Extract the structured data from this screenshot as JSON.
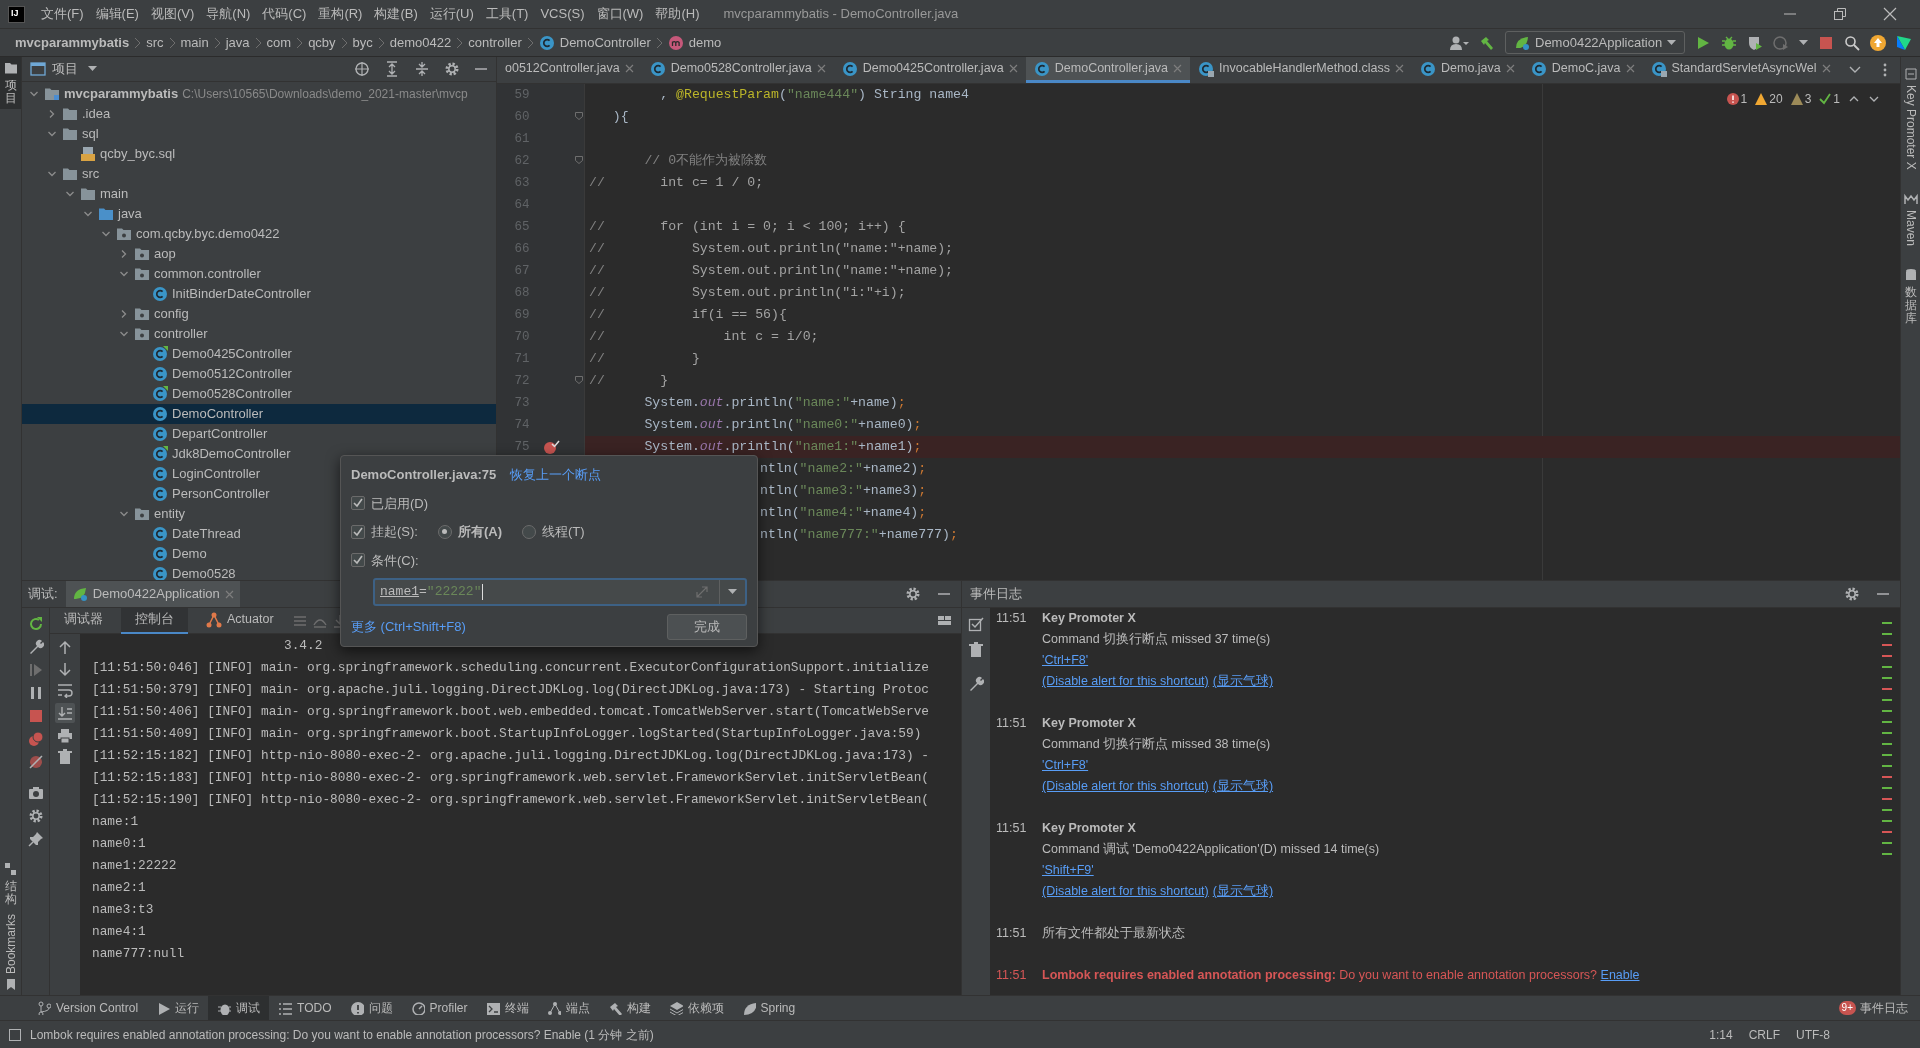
{
  "title_bar": {
    "logo": "IJ",
    "menu": [
      "文件(F)",
      "编辑(E)",
      "视图(V)",
      "导航(N)",
      "代码(C)",
      "重构(R)",
      "构建(B)",
      "运行(U)",
      "工具(T)",
      "VCS(S)",
      "窗口(W)",
      "帮助(H)"
    ],
    "title": "mvcparammybatis - DemoController.java"
  },
  "breadcrumbs": [
    {
      "label": "mvcparammybatis",
      "kind": "project"
    },
    {
      "label": "src",
      "kind": "dir"
    },
    {
      "label": "main",
      "kind": "dir"
    },
    {
      "label": "java",
      "kind": "dir"
    },
    {
      "label": "com",
      "kind": "dir"
    },
    {
      "label": "qcby",
      "kind": "dir"
    },
    {
      "label": "byc",
      "kind": "dir"
    },
    {
      "label": "demo0422",
      "kind": "dir"
    },
    {
      "label": "controller",
      "kind": "dir"
    },
    {
      "label": "DemoController",
      "kind": "class"
    },
    {
      "label": "demo",
      "kind": "method"
    }
  ],
  "run_config": {
    "label": "Demo0422Application"
  },
  "left_tool_windows": [
    {
      "label": "项目",
      "kind": "cjk",
      "selected": true
    },
    {
      "label": "结构",
      "kind": "cjk",
      "selected": false
    },
    {
      "label": "Bookmarks",
      "kind": "latin",
      "selected": false
    }
  ],
  "right_tool_windows": [
    {
      "label": "Key Promoter X",
      "kind": "latin"
    },
    {
      "label": "Maven",
      "kind": "latin"
    },
    {
      "label": "数据库",
      "kind": "cjk"
    }
  ],
  "project_panel": {
    "title": "项目",
    "tree": [
      {
        "label": "mvcparammybatis",
        "kind": "module",
        "path": "C:\\Users\\10565\\Downloads\\demo_2021-master\\mvcp",
        "expanded": true,
        "selected": false,
        "children": [
          {
            "label": ".idea",
            "kind": "folder",
            "expanded": false,
            "selected": false
          },
          {
            "label": "sql",
            "kind": "folder",
            "expanded": true,
            "selected": false,
            "children": [
              {
                "label": "qcby_byc.sql",
                "kind": "sql",
                "selected": false
              }
            ]
          },
          {
            "label": "src",
            "kind": "folder",
            "expanded": true,
            "selected": false,
            "children": [
              {
                "label": "main",
                "kind": "folder",
                "expanded": true,
                "selected": false,
                "children": [
                  {
                    "label": "java",
                    "kind": "source",
                    "expanded": true,
                    "selected": false,
                    "children": [
                      {
                        "label": "com.qcby.byc.demo0422",
                        "kind": "package",
                        "expanded": true,
                        "selected": false,
                        "children": [
                          {
                            "label": "aop",
                            "kind": "package",
                            "expanded": false,
                            "selected": false
                          },
                          {
                            "label": "common.controller",
                            "kind": "package",
                            "expanded": true,
                            "selected": false,
                            "children": [
                              {
                                "label": "InitBinderDateController",
                                "kind": "class",
                                "selected": false
                              }
                            ]
                          },
                          {
                            "label": "config",
                            "kind": "package",
                            "expanded": false,
                            "selected": false
                          },
                          {
                            "label": "controller",
                            "kind": "package",
                            "expanded": true,
                            "selected": false,
                            "children": [
                              {
                                "label": "Demo0425Controller",
                                "kind": "spring-class",
                                "selected": false
                              },
                              {
                                "label": "Demo0512Controller",
                                "kind": "class",
                                "selected": false
                              },
                              {
                                "label": "Demo0528Controller",
                                "kind": "spring-class",
                                "selected": false
                              },
                              {
                                "label": "DemoController",
                                "kind": "class",
                                "selected": true
                              },
                              {
                                "label": "DepartController",
                                "kind": "class",
                                "selected": false
                              },
                              {
                                "label": "Jdk8DemoController",
                                "kind": "spring-class",
                                "selected": false
                              },
                              {
                                "label": "LoginController",
                                "kind": "class",
                                "selected": false
                              },
                              {
                                "label": "PersonController",
                                "kind": "class",
                                "selected": false
                              }
                            ]
                          },
                          {
                            "label": "entity",
                            "kind": "package",
                            "expanded": true,
                            "selected": false,
                            "children": [
                              {
                                "label": "DateThread",
                                "kind": "class",
                                "selected": false
                              },
                              {
                                "label": "Demo",
                                "kind": "class",
                                "selected": false
                              },
                              {
                                "label": "Demo0528",
                                "kind": "class",
                                "selected": false
                              }
                            ]
                          }
                        ]
                      }
                    ]
                  }
                ]
              }
            ]
          }
        ]
      }
    ]
  },
  "editor": {
    "tabs": [
      {
        "label": "o0512Controller.java",
        "kind": "none",
        "selected": false
      },
      {
        "label": "Demo0528Controller.java",
        "kind": "class",
        "selected": false
      },
      {
        "label": "Demo0425Controller.java",
        "kind": "class",
        "selected": false
      },
      {
        "label": "DemoController.java",
        "kind": "class",
        "selected": true
      },
      {
        "label": "InvocableHandlerMethod.class",
        "kind": "library",
        "selected": false
      },
      {
        "label": "Demo.java",
        "kind": "class",
        "selected": false
      },
      {
        "label": "DemoC.java",
        "kind": "class",
        "selected": false
      },
      {
        "label": "StandardServletAsyncWel",
        "kind": "library",
        "selected": false
      }
    ],
    "inspections": [
      {
        "kind": "error",
        "count": "1"
      },
      {
        "kind": "warning",
        "count": "20"
      },
      {
        "kind": "weak",
        "count": "3"
      },
      {
        "kind": "ok",
        "count": "1"
      }
    ],
    "lines": [
      {
        "number": "59",
        "breakpoint": false,
        "foldable": false,
        "segments": [
          {
            "kind": "plain",
            "text": "         , "
          },
          {
            "kind": "annotation",
            "text": "@RequestParam"
          },
          {
            "kind": "plain",
            "text": "("
          },
          {
            "kind": "str",
            "text": "\"name444\""
          },
          {
            "kind": "plain",
            "text": ") String name4"
          }
        ]
      },
      {
        "number": "60",
        "breakpoint": false,
        "foldable": true,
        "segments": [
          {
            "kind": "plain",
            "text": "   ){"
          }
        ]
      },
      {
        "number": "61",
        "breakpoint": false,
        "foldable": false
      },
      {
        "number": "62",
        "breakpoint": false,
        "foldable": true,
        "segments": [
          {
            "kind": "comment",
            "text": "       // 0不能作为被除数"
          }
        ]
      },
      {
        "number": "63",
        "breakpoint": false,
        "foldable": false,
        "segments": [
          {
            "kind": "comment",
            "text": "//"
          },
          {
            "kind": "muted",
            "text": "       int c= 1 / 0;"
          }
        ]
      },
      {
        "number": "64",
        "breakpoint": false,
        "foldable": false
      },
      {
        "number": "65",
        "breakpoint": false,
        "foldable": false,
        "segments": [
          {
            "kind": "comment",
            "text": "//"
          },
          {
            "kind": "muted",
            "text": "       for (int i = 0; i < 100; i++) {"
          }
        ]
      },
      {
        "number": "66",
        "breakpoint": false,
        "foldable": false,
        "segments": [
          {
            "kind": "comment",
            "text": "//"
          },
          {
            "kind": "muted",
            "text": "           System.out.println(\"name:\"+name);"
          }
        ]
      },
      {
        "number": "67",
        "breakpoint": false,
        "foldable": false,
        "segments": [
          {
            "kind": "comment",
            "text": "//"
          },
          {
            "kind": "muted",
            "text": "           System.out.println(\"name:\"+name);"
          }
        ]
      },
      {
        "number": "68",
        "breakpoint": false,
        "foldable": false,
        "segments": [
          {
            "kind": "comment",
            "text": "//"
          },
          {
            "kind": "muted",
            "text": "           System.out.println(\"i:\"+i);"
          }
        ]
      },
      {
        "number": "69",
        "breakpoint": false,
        "foldable": false,
        "segments": [
          {
            "kind": "comment",
            "text": "//"
          },
          {
            "kind": "muted",
            "text": "           if(i == 56){"
          }
        ]
      },
      {
        "number": "70",
        "breakpoint": false,
        "foldable": false,
        "segments": [
          {
            "kind": "comment",
            "text": "//"
          },
          {
            "kind": "muted",
            "text": "               int c = i/0;"
          }
        ]
      },
      {
        "number": "71",
        "breakpoint": false,
        "foldable": false,
        "segments": [
          {
            "kind": "comment",
            "text": "//"
          },
          {
            "kind": "muted",
            "text": "           }"
          }
        ]
      },
      {
        "number": "72",
        "breakpoint": false,
        "foldable": true,
        "segments": [
          {
            "kind": "comment",
            "text": "//"
          },
          {
            "kind": "muted",
            "text": "       }"
          }
        ]
      },
      {
        "number": "73",
        "breakpoint": false,
        "foldable": false,
        "segments": [
          {
            "kind": "plain",
            "text": "       System."
          },
          {
            "kind": "field",
            "text": "out"
          },
          {
            "kind": "plain",
            "text": ".println("
          },
          {
            "kind": "str",
            "text": "\"name:\""
          },
          {
            "kind": "plain",
            "text": "+name)"
          },
          {
            "kind": "punct",
            "text": ";"
          }
        ]
      },
      {
        "number": "74",
        "breakpoint": false,
        "foldable": false,
        "segments": [
          {
            "kind": "plain",
            "text": "       System."
          },
          {
            "kind": "field",
            "text": "out"
          },
          {
            "kind": "plain",
            "text": ".println("
          },
          {
            "kind": "str",
            "text": "\"name0:\""
          },
          {
            "kind": "plain",
            "text": "+name0)"
          },
          {
            "kind": "punct",
            "text": ";"
          }
        ]
      },
      {
        "number": "75",
        "breakpoint": true,
        "foldable": false,
        "segments": [
          {
            "kind": "plain",
            "text": "       System."
          },
          {
            "kind": "field",
            "text": "out"
          },
          {
            "kind": "plain",
            "text": ".println("
          },
          {
            "kind": "str",
            "text": "\"name1:\""
          },
          {
            "kind": "plain",
            "text": "+name1)"
          },
          {
            "kind": "punct",
            "text": ";"
          }
        ]
      },
      {
        "breakpoint": false,
        "foldable": false,
        "segments": [
          {
            "kind": "plain",
            "text": "ntln("
          },
          {
            "kind": "str",
            "text": "\"name2:\""
          },
          {
            "kind": "plain",
            "text": "+name2)"
          },
          {
            "kind": "punct",
            "text": ";"
          }
        ]
      },
      {
        "breakpoint": false,
        "foldable": false,
        "segments": [
          {
            "kind": "plain",
            "text": "ntln("
          },
          {
            "kind": "str",
            "text": "\"name3:\""
          },
          {
            "kind": "plain",
            "text": "+name3)"
          },
          {
            "kind": "punct",
            "text": ";"
          }
        ]
      },
      {
        "breakpoint": false,
        "foldable": false,
        "segments": [
          {
            "kind": "plain",
            "text": "ntln("
          },
          {
            "kind": "str",
            "text": "\"name4:\""
          },
          {
            "kind": "plain",
            "text": "+name4)"
          },
          {
            "kind": "punct",
            "text": ";"
          }
        ]
      },
      {
        "breakpoint": false,
        "foldable": false,
        "segments": [
          {
            "kind": "plain",
            "text": "ntln("
          },
          {
            "kind": "str",
            "text": "\"name777:\""
          },
          {
            "kind": "plain",
            "text": "+name777)"
          },
          {
            "kind": "punct",
            "text": ";"
          }
        ]
      }
    ]
  },
  "breakpoint_popup": {
    "title": "DemoController.java:75",
    "restore_link": "恢复上一个断点",
    "enabled": {
      "label": "已启用(D)",
      "checked": true
    },
    "suspend": {
      "label": "挂起(S):",
      "checked": true,
      "options": [
        {
          "label": "所有(A)",
          "selected": true
        },
        {
          "label": "线程(T)",
          "selected": false
        }
      ]
    },
    "condition": {
      "label": "条件(C):",
      "checked": true,
      "value": [
        {
          "kind": "ident",
          "text": "name1"
        },
        {
          "kind": "plain",
          "text": "="
        },
        {
          "kind": "str",
          "text": "\"22222\""
        }
      ]
    },
    "more_link": "更多 (Ctrl+Shift+F8)",
    "done": "完成"
  },
  "debug_panel": {
    "label": "调试:",
    "session": "Demo0422Application",
    "subtabs": [
      {
        "label": "调试器",
        "selected": false
      },
      {
        "label": "控制台",
        "selected": true
      },
      {
        "label": "Actuator",
        "selected": false
      }
    ],
    "console": [
      "                         3.4.2",
      "[11:51:50:046] [INFO] main- org.springframework.scheduling.concurrent.ExecutorConfigurationSupport.initialize",
      "[11:51:50:379] [INFO] main- org.apache.juli.logging.DirectJDKLog.log(DirectJDKLog.java:173) - Starting Protoc",
      "[11:51:50:406] [INFO] main- org.springframework.boot.web.embedded.tomcat.TomcatWebServer.start(TomcatWebServe",
      "[11:51:50:409] [INFO] main- org.springframework.boot.StartupInfoLogger.logStarted(StartupInfoLogger.java:59)",
      "[11:52:15:182] [INFO] http-nio-8080-exec-2- org.apache.juli.logging.DirectJDKLog.log(DirectJDKLog.java:173) -",
      "[11:52:15:183] [INFO] http-nio-8080-exec-2- org.springframework.web.servlet.FrameworkServlet.initServletBean(",
      "[11:52:15:190] [INFO] http-nio-8080-exec-2- org.springframework.web.servlet.FrameworkServlet.initServletBean(",
      "name:1",
      "name0:1",
      "name1:22222",
      "name2:1",
      "name3:t3",
      "name4:1",
      "name777:null"
    ]
  },
  "event_log": {
    "title": "事件日志",
    "entries": [
      {
        "kind": "info",
        "time": "11:51",
        "title": "Key Promoter X",
        "message": "Command 切换行断点 missed 37 time(s)",
        "shortcut": "'Ctrl+F8'",
        "links": [
          "(Disable alert for this shortcut)",
          "(显示气球)"
        ]
      },
      {
        "kind": "info",
        "time": "11:51",
        "title": "Key Promoter X",
        "message": "Command 切换行断点 missed 38 time(s)",
        "shortcut": "'Ctrl+F8'",
        "links": [
          "(Disable alert for this shortcut)",
          "(显示气球)"
        ]
      },
      {
        "kind": "info",
        "time": "11:51",
        "title": "Key Promoter X",
        "message": "Command 调试 'Demo0422Application'(D) missed 14 time(s)",
        "shortcut": "'Shift+F9'",
        "links": [
          "(Disable alert for this shortcut)",
          "(显示气球)"
        ]
      },
      {
        "kind": "info",
        "time": "11:51",
        "message": "所有文件都处于最新状态"
      },
      {
        "kind": "error",
        "time": "11:51",
        "message": "**Lombok requires enabled annotation processing:** Do you want to enable annotation processors?",
        "action": "Enable"
      }
    ]
  },
  "tool_windows": [
    {
      "label": "Version Control",
      "selected": false
    },
    {
      "label": "运行",
      "selected": false
    },
    {
      "label": "调试",
      "selected": true
    },
    {
      "label": "TODO",
      "selected": false
    },
    {
      "label": "问题",
      "selected": false
    },
    {
      "label": "Profiler",
      "selected": false
    },
    {
      "label": "终端",
      "selected": false
    },
    {
      "label": "端点",
      "selected": false
    },
    {
      "label": "构建",
      "selected": false
    },
    {
      "label": "依赖项",
      "selected": false
    },
    {
      "label": "Spring",
      "selected": false
    }
  ],
  "event_badge": {
    "count": "9+",
    "label": "事件日志"
  },
  "status_bar": {
    "message": "Lombok requires enabled annotation processing: Do you want to enable annotation processors? Enable (1 分钟 之前)",
    "position": "1:14",
    "line_ending": "CRLF",
    "encoding": "UTF-8"
  }
}
